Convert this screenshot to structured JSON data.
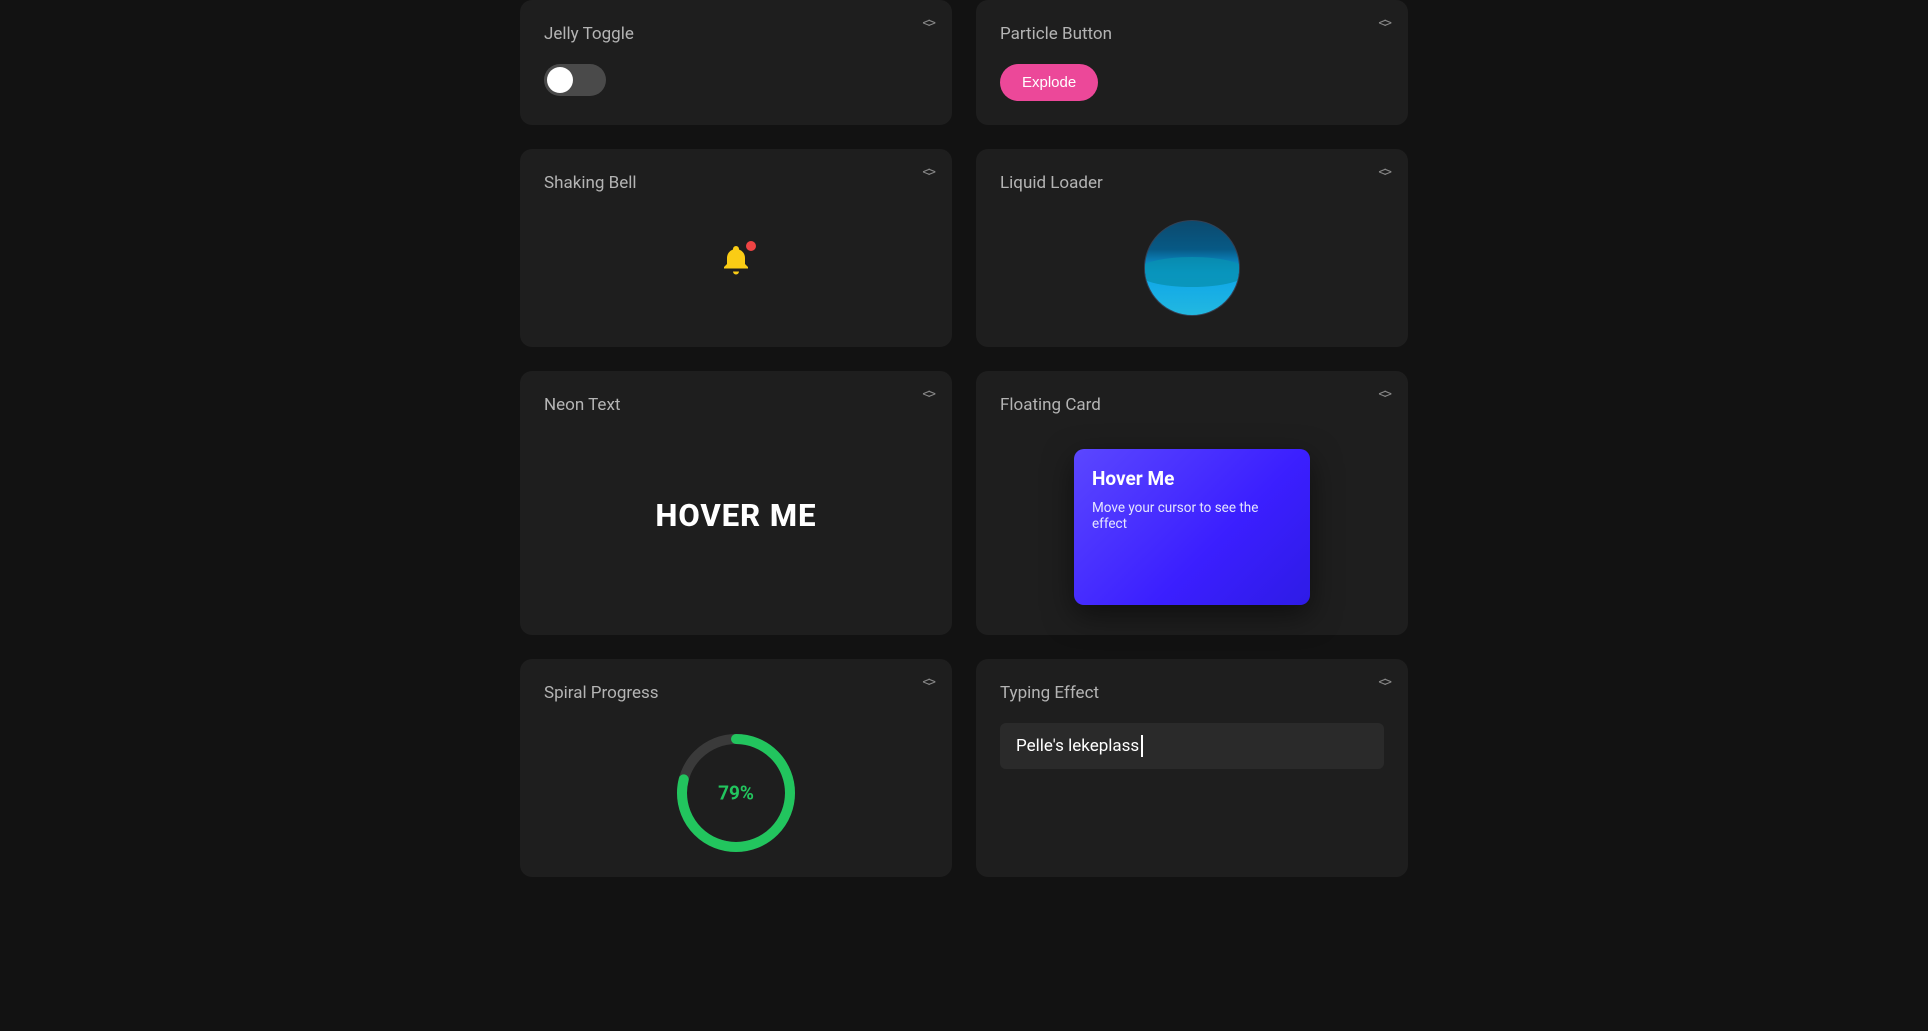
{
  "cards": {
    "jelly_toggle": {
      "title": "Jelly Toggle"
    },
    "particle_button": {
      "title": "Particle Button",
      "button_label": "Explode"
    },
    "shaking_bell": {
      "title": "Shaking Bell"
    },
    "liquid_loader": {
      "title": "Liquid Loader"
    },
    "neon_text": {
      "title": "Neon Text",
      "content": "HOVER ME"
    },
    "floating_card": {
      "title": "Floating Card",
      "inner_title": "Hover Me",
      "inner_sub": "Move your cursor to see the effect"
    },
    "spiral_progress": {
      "title": "Spiral Progress",
      "percent_label": "79%"
    },
    "typing_effect": {
      "title": "Typing Effect",
      "text": "Pelle's lekeplass"
    }
  },
  "colors": {
    "bg": "#121212",
    "card": "#1e1e1e",
    "accent_pink": "#ec4899",
    "accent_green": "#22c55e",
    "accent_yellow": "#facc15",
    "accent_blue": "#3b1fff",
    "accent_cyan": "#0ea5e9"
  }
}
